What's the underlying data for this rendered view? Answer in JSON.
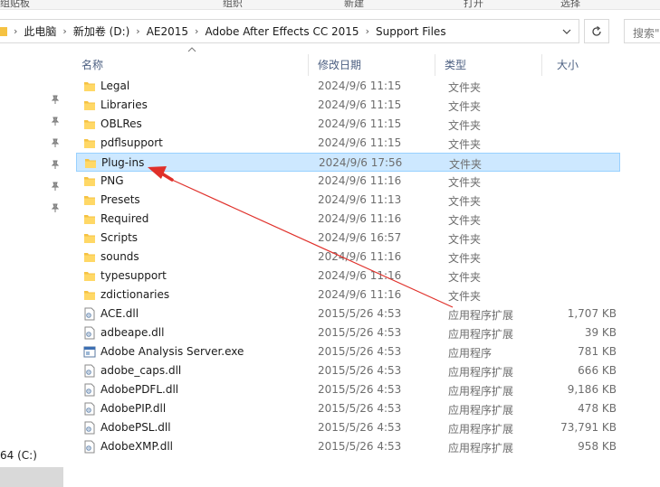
{
  "ribbon": {
    "group1": "组贴板",
    "group2": "组织",
    "group3": "新建",
    "group4": "打开",
    "group5": "选择"
  },
  "address": {
    "crumbs": [
      "此电脑",
      "新加卷 (D:)",
      "AE2015",
      "Adobe After Effects CC 2015",
      "Support Files"
    ]
  },
  "search": {
    "placeholder": "搜索\""
  },
  "nav": {
    "drive_label": "64 (C:)"
  },
  "columns": {
    "name": "名称",
    "date": "修改日期",
    "type": "类型",
    "size": "大小"
  },
  "files": [
    {
      "name": "Legal",
      "date": "2024/9/6 11:15",
      "type": "文件夹",
      "size": "",
      "icon": "folder"
    },
    {
      "name": "Libraries",
      "date": "2024/9/6 11:15",
      "type": "文件夹",
      "size": "",
      "icon": "folder"
    },
    {
      "name": "OBLRes",
      "date": "2024/9/6 11:15",
      "type": "文件夹",
      "size": "",
      "icon": "folder"
    },
    {
      "name": "pdflsupport",
      "date": "2024/9/6 11:15",
      "type": "文件夹",
      "size": "",
      "icon": "folder"
    },
    {
      "name": "Plug-ins",
      "date": "2024/9/6 17:56",
      "type": "文件夹",
      "size": "",
      "icon": "folder"
    },
    {
      "name": "PNG",
      "date": "2024/9/6 11:16",
      "type": "文件夹",
      "size": "",
      "icon": "folder"
    },
    {
      "name": "Presets",
      "date": "2024/9/6 11:13",
      "type": "文件夹",
      "size": "",
      "icon": "folder"
    },
    {
      "name": "Required",
      "date": "2024/9/6 11:16",
      "type": "文件夹",
      "size": "",
      "icon": "folder"
    },
    {
      "name": "Scripts",
      "date": "2024/9/6 16:57",
      "type": "文件夹",
      "size": "",
      "icon": "folder"
    },
    {
      "name": "sounds",
      "date": "2024/9/6 11:16",
      "type": "文件夹",
      "size": "",
      "icon": "folder"
    },
    {
      "name": "typesupport",
      "date": "2024/9/6 11:16",
      "type": "文件夹",
      "size": "",
      "icon": "folder"
    },
    {
      "name": "zdictionaries",
      "date": "2024/9/6 11:16",
      "type": "文件夹",
      "size": "",
      "icon": "folder"
    },
    {
      "name": "ACE.dll",
      "date": "2015/5/26 4:53",
      "type": "应用程序扩展",
      "size": "1,707 KB",
      "icon": "dll"
    },
    {
      "name": "adbeape.dll",
      "date": "2015/5/26 4:53",
      "type": "应用程序扩展",
      "size": "39 KB",
      "icon": "dll"
    },
    {
      "name": "Adobe Analysis Server.exe",
      "date": "2015/5/26 4:53",
      "type": "应用程序",
      "size": "781 KB",
      "icon": "exe"
    },
    {
      "name": "adobe_caps.dll",
      "date": "2015/5/26 4:53",
      "type": "应用程序扩展",
      "size": "666 KB",
      "icon": "dll"
    },
    {
      "name": "AdobePDFL.dll",
      "date": "2015/5/26 4:53",
      "type": "应用程序扩展",
      "size": "9,186 KB",
      "icon": "dll"
    },
    {
      "name": "AdobePIP.dll",
      "date": "2015/5/26 4:53",
      "type": "应用程序扩展",
      "size": "478 KB",
      "icon": "dll"
    },
    {
      "name": "AdobePSL.dll",
      "date": "2015/5/26 4:53",
      "type": "应用程序扩展",
      "size": "73,791 KB",
      "icon": "dll"
    },
    {
      "name": "AdobeXMP.dll",
      "date": "2015/5/26 4:53",
      "type": "应用程序扩展",
      "size": "958 KB",
      "icon": "dll"
    }
  ],
  "selected_index": 4,
  "colors": {
    "selection_bg": "#cde8ff",
    "selection_border": "#99d1ff",
    "annotation_arrow": "#e0302a",
    "folder": "#f5c242",
    "header_text": "#4d6082"
  }
}
